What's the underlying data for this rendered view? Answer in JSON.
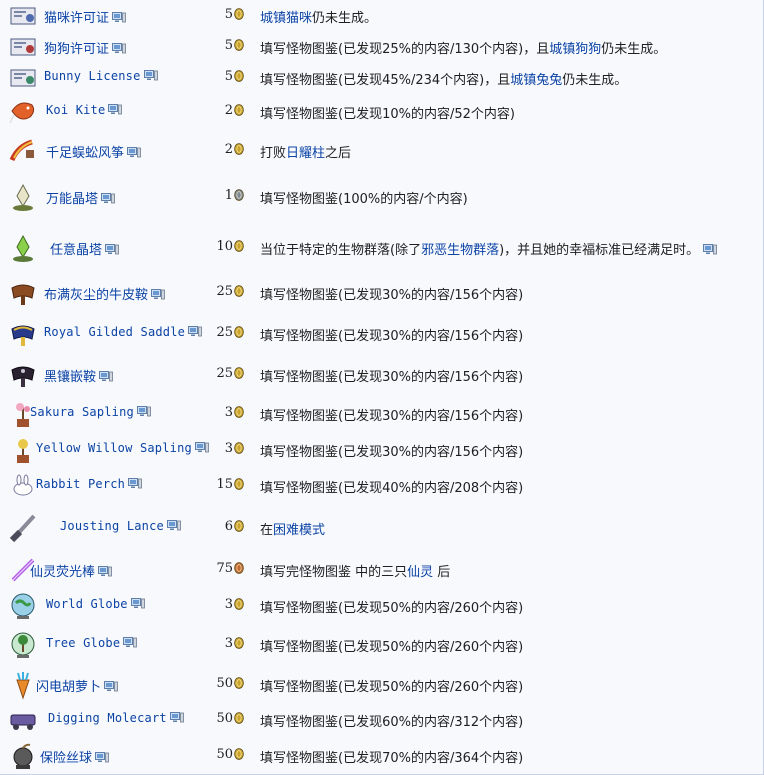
{
  "rows": [
    {
      "name": "猫咪许可证",
      "latin": false,
      "price": "5",
      "coin": "gold",
      "icon": "cat-license-icon",
      "cond": [
        {
          "t": "城镇猫咪",
          "link": true
        },
        {
          "t": "仍未生成。"
        }
      ]
    },
    {
      "name": "狗狗许可证",
      "latin": false,
      "price": "5",
      "coin": "gold",
      "icon": "dog-license-icon",
      "cond": [
        {
          "t": "填写怪物图鉴(已发现25%的内容/130个内容)，且"
        },
        {
          "t": "城镇狗狗",
          "link": true
        },
        {
          "t": "仍未生成。"
        }
      ]
    },
    {
      "name": "Bunny License",
      "latin": true,
      "price": "5",
      "coin": "gold",
      "icon": "bunny-license-icon",
      "cond": [
        {
          "t": "填写怪物图鉴(已发现45%/234个内容)，且"
        },
        {
          "t": "城镇兔兔",
          "link": true
        },
        {
          "t": "仍未生成。"
        }
      ]
    },
    {
      "name": "Koi Kite",
      "latin": true,
      "price": "2",
      "coin": "gold",
      "icon": "koi-kite-icon",
      "cond": [
        {
          "t": "填写怪物图鉴(已发现10%的内容/52个内容)"
        }
      ]
    },
    {
      "name": "千足蜈蚣风筝",
      "latin": false,
      "price": "2",
      "coin": "gold",
      "icon": "centipede-kite-icon",
      "cond": [
        {
          "t": "打败"
        },
        {
          "t": "日耀柱",
          "link": true
        },
        {
          "t": "之后"
        }
      ]
    },
    {
      "name": "万能晶塔",
      "latin": false,
      "price": "1",
      "coin": "platinum",
      "icon": "universal-pylon-icon",
      "cond": [
        {
          "t": "填写怪物图鉴(100%的内容/个内容)"
        }
      ]
    },
    {
      "name": "任意晶塔",
      "latin": false,
      "price": "10",
      "coin": "gold",
      "icon": "any-pylon-icon",
      "cond": [
        {
          "t": "当位于特定的生物群落(除了"
        },
        {
          "t": "邪恶生物群落",
          "link": true
        },
        {
          "t": ")，并且她的幸福标准已经满足时。"
        },
        {
          "t": "",
          "pc": true
        }
      ]
    },
    {
      "name": "布满灰尘的牛皮鞍",
      "latin": false,
      "price": "25",
      "coin": "gold",
      "icon": "dusty-saddle-icon",
      "cond": [
        {
          "t": "填写怪物图鉴(已发现30%的内容/156个内容)"
        }
      ]
    },
    {
      "name": "Royal Gilded Saddle",
      "latin": true,
      "price": "25",
      "coin": "gold",
      "icon": "royal-saddle-icon",
      "cond": [
        {
          "t": "填写怪物图鉴(已发现30%的内容/156个内容)"
        }
      ]
    },
    {
      "name": "黑镶嵌鞍",
      "latin": false,
      "price": "25",
      "coin": "gold",
      "icon": "black-saddle-icon",
      "cond": [
        {
          "t": "填写怪物图鉴(已发现30%的内容/156个内容)"
        }
      ]
    },
    {
      "name": "Sakura Sapling",
      "latin": true,
      "price": "3",
      "coin": "gold",
      "icon": "sakura-sapling-icon",
      "cond": [
        {
          "t": "填写怪物图鉴(已发现30%的内容/156个内容)"
        }
      ]
    },
    {
      "name": "Yellow Willow Sapling",
      "latin": true,
      "price": "3",
      "coin": "gold",
      "icon": "willow-sapling-icon",
      "cond": [
        {
          "t": "填写怪物图鉴(已发现30%的内容/156个内容)"
        }
      ]
    },
    {
      "name": "Rabbit Perch",
      "latin": true,
      "price": "15",
      "coin": "gold",
      "icon": "rabbit-perch-icon",
      "cond": [
        {
          "t": "填写怪物图鉴(已发现40%的内容/208个内容)"
        }
      ]
    },
    {
      "name": "Jousting Lance",
      "latin": true,
      "price": "6",
      "coin": "gold",
      "icon": "jousting-lance-icon",
      "cond": [
        {
          "t": "在"
        },
        {
          "t": "困难模式",
          "link": true
        }
      ]
    },
    {
      "name": "仙灵荧光棒",
      "latin": false,
      "price": "75",
      "coin": "copper",
      "icon": "fairy-glowstick-icon",
      "cond": [
        {
          "t": "填写完怪物图鉴 中的三只"
        },
        {
          "t": "仙灵",
          "link": true
        },
        {
          "t": " 后"
        }
      ]
    },
    {
      "name": "World Globe",
      "latin": true,
      "price": "3",
      "coin": "gold",
      "icon": "world-globe-icon",
      "cond": [
        {
          "t": "填写怪物图鉴(已发现50%的内容/260个内容)"
        }
      ]
    },
    {
      "name": "Tree Globe",
      "latin": true,
      "price": "3",
      "coin": "gold",
      "icon": "tree-globe-icon",
      "cond": [
        {
          "t": "填写怪物图鉴(已发现50%的内容/260个内容)"
        }
      ]
    },
    {
      "name": "闪电胡萝卜",
      "latin": false,
      "price": "50",
      "coin": "gold",
      "icon": "lightning-carrot-icon",
      "cond": [
        {
          "t": "填写怪物图鉴(已发现50%的内容/260个内容)"
        }
      ]
    },
    {
      "name": "Digging Molecart",
      "latin": true,
      "price": "50",
      "coin": "gold",
      "icon": "digging-molecart-icon",
      "cond": [
        {
          "t": "填写怪物图鉴(已发现60%的内容/312个内容)"
        }
      ]
    },
    {
      "name": "保险丝球",
      "latin": false,
      "price": "50",
      "coin": "gold",
      "icon": "fuse-ball-icon",
      "cond": [
        {
          "t": "填写怪物图鉴(已发现70%的内容/364个内容)"
        }
      ]
    }
  ],
  "colors": {
    "link": "#0b44a6",
    "text": "#202020",
    "gold": "#c9a227",
    "platinum": "#7d8796",
    "copper": "#c0682f"
  }
}
